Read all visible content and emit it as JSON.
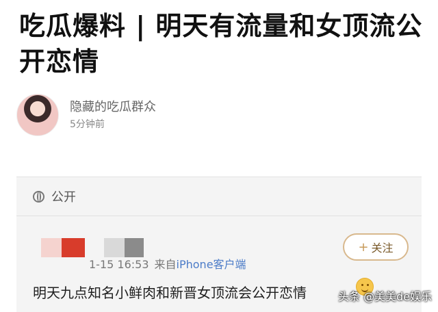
{
  "article": {
    "headline": "吃瓜爆料 | 明天有流量和女顶流公开恋情",
    "author_name": "隐藏的吃瓜群众",
    "posted_time": "5分钟前"
  },
  "post": {
    "visibility_label": "公开",
    "follow_label": "关注",
    "meta_date": "1-15 16:53",
    "meta_from": "来自",
    "meta_device": "iPhone客户端",
    "text": "明天九点知名小鲜肉和新晋女顶流会公开恋情"
  },
  "watermark": "头条 @美美de娱乐",
  "icons": {
    "avatar": "avatar-image",
    "globe": "globe-icon",
    "plus": "plus-icon",
    "emoji": "emoji-icon"
  },
  "colors": {
    "red_block": "#d83c2b",
    "follow_border": "#d8b88d"
  }
}
